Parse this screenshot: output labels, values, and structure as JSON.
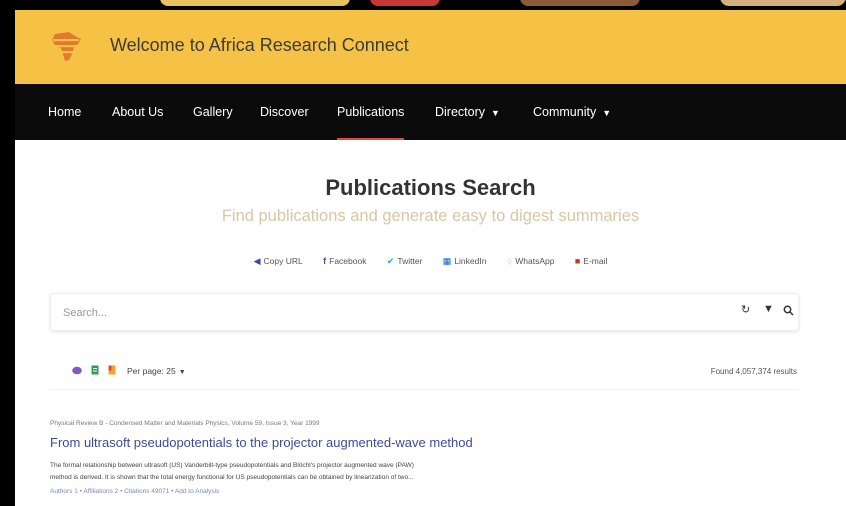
{
  "site": {
    "title": "Welcome to Africa Research Connect"
  },
  "colors": {
    "header_bg": "#f6c245",
    "nav_bg": "#0b0b0b",
    "accent": "#e0473a",
    "link": "#3f4a97"
  },
  "nav": {
    "home": "Home",
    "about": "About Us",
    "gallery": "Gallery",
    "discover": "Discover",
    "publications": "Publications",
    "directory": "Directory",
    "community": "Community"
  },
  "page": {
    "title": "Publications Search",
    "subtitle": "Find publications and generate easy to digest summaries"
  },
  "share": {
    "copy": "Copy URL",
    "facebook": "Facebook",
    "twitter": "Twitter",
    "linkedin": "LinkedIn",
    "whatsapp": "WhatsApp",
    "email": "E-mail"
  },
  "search": {
    "placeholder": "Search...",
    "value": ""
  },
  "results_toolbar": {
    "per_page": "Per page: 25",
    "found": "Found 4,057,374 results"
  },
  "result": {
    "meta": "Physical Review B - Condensed Matter and Materials Physics, Volume 59, Issue 3, Year 1999",
    "title": "From ultrasoft pseudopotentials to the projector augmented-wave method",
    "abstract_line1": "The formal relationship between ultrasoft (US) Vanderbilt-type pseudopotentials and Blöchl's projector augmented wave (PAW)",
    "abstract_line2": "method is derived. It is shown that the total energy functional for US pseudopotentials can be obtained by linearization of two...",
    "authors": "Authors 1",
    "affiliations": "Affiliations 2",
    "citations": "Citations 49071",
    "analysis": "Add to Analysis"
  }
}
